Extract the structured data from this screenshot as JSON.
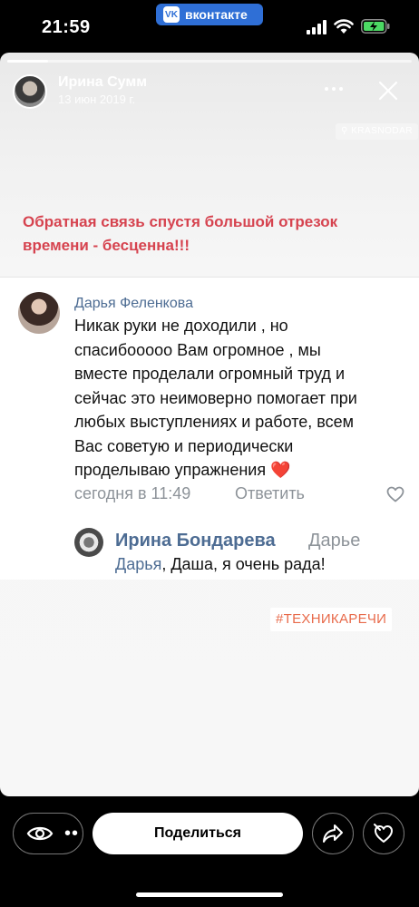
{
  "status_bar": {
    "time": "21:59",
    "app_pill": "вконтакте",
    "vk_logo": "VK",
    "icons": [
      "signal-icon",
      "wifi-icon",
      "battery-charging-icon"
    ]
  },
  "story": {
    "progress_fraction": 0.1,
    "author": {
      "name": "Ирина Сумм",
      "date": "13 июн 2019 г."
    },
    "location": "KRASNODAR",
    "headline": "Обратная связь спустя большой отрезок времени - бесценна!!!",
    "comment": {
      "author": "Дарья Феленкова",
      "text": "Никак руки не доходили , но спасибооооо Вам огромное , мы вместе проделали огромный труд и сейчас это неимоверно помогает при любых выступлениях и работе, всем Вас советую и периодически проделываю упражнения",
      "emoji": "❤️",
      "time": "сегодня в 11:49",
      "reply_label": "Ответить"
    },
    "reply": {
      "author": "Ирина Бондарева",
      "to": "Дарье",
      "mention": "Дарья",
      "text": ", Даша, я очень рада!"
    },
    "hashtag": "#ТЕХНИКАРЕЧИ"
  },
  "bottom_bar": {
    "views_dots": "••",
    "share_label": "Поделиться"
  },
  "colors": {
    "headline": "#d6434f",
    "link": "#4d6c93",
    "meta": "#8d9399",
    "vk_blue": "#2f6fd6",
    "hashtag": "#e86a4a"
  }
}
